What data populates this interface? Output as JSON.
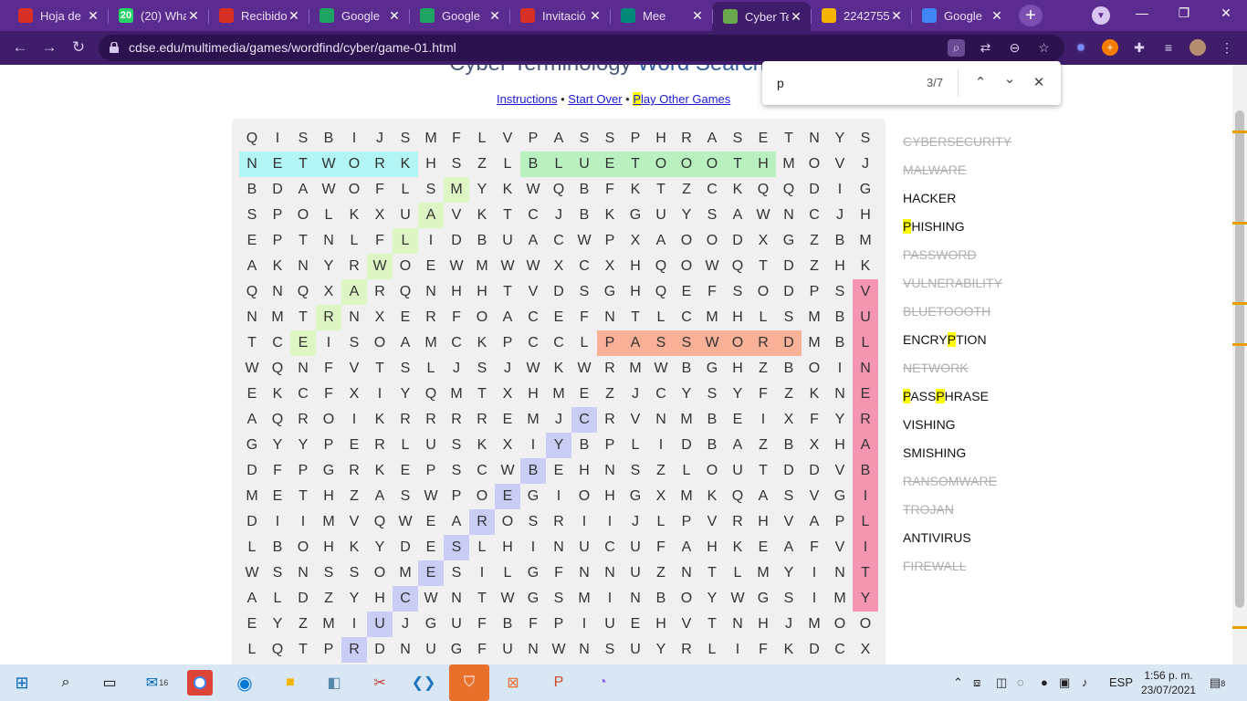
{
  "tabs": [
    {
      "title": "Hoja de",
      "icon": "gmail-icon",
      "color": "#d93025"
    },
    {
      "title": "(20) Wha",
      "icon": "whatsapp-icon",
      "color": "#25d366",
      "badge": "20"
    },
    {
      "title": "Recibido",
      "icon": "gmail-icon",
      "color": "#d93025"
    },
    {
      "title": "Google",
      "icon": "google-drive-icon",
      "color": "#1fa463"
    },
    {
      "title": "Google",
      "icon": "google-drive-icon",
      "color": "#1fa463"
    },
    {
      "title": "Invitació",
      "icon": "gmail-icon",
      "color": "#d93025"
    },
    {
      "title": "Mee",
      "icon": "google-meet-icon",
      "color": "#00897b"
    },
    {
      "title": "Cyber Te",
      "icon": "cdse-icon",
      "color": "#6aa84f"
    },
    {
      "title": "2242755",
      "icon": "google-drive-icon",
      "color": "#f4b400"
    },
    {
      "title": "Google",
      "icon": "google-icon",
      "color": "#4285f4"
    }
  ],
  "address_bar": {
    "url": "cdse.edu/multimedia/games/wordfind/cyber/game-01.html"
  },
  "page": {
    "title_part1": "Cyber Terminology",
    "title_part2": "Word Search",
    "links": {
      "instructions": "Instructions",
      "start_over": "Start Over",
      "play_other_p": "P",
      "play_other_rest": "lay Other Games",
      "separator": "•"
    }
  },
  "find_bar": {
    "query": "p",
    "count": "3/7"
  },
  "grid": [
    "QISBIJSMFLVPASSPHRASETNYS",
    "NETWORKHSZLBLUETOOOTHMOVJ",
    "BDAWOFLSMYKWQBFKTZCKQQDIG",
    "SPOLKXUAVKTCJBKGUYSAWNCJH",
    "EPTNLFLIDBUACWPXAOODXGZBM",
    "AKNYRWOEWMWWXCXHQOWQTDZHK",
    "QNQXARQNHHTVDSGHQEFSODPSV",
    "NMTRNXERFOACEFNTLCMHLSMBU",
    "TCEISOAMCKPCCLPASSWORDMBL",
    "WQNFVTSLJSJWKWRMWBGHZBOIN",
    "EKCFXIYQMTXHMEZJCYSYFZKNE",
    "AQROIKRRRREMJCRVNMBEIXFYR",
    "GYYPERLUSKXIYBPLIDBAZBXHA",
    "DFPGRKEPSCWBEHNSZLOUTDDVB",
    "METHZASWPOEGIOHGXMKQASVGI",
    "DIIMVQWEAROSRIIJLPVRHVAPL",
    "LBOHKYDESLHINUCUFAHKEAFVI",
    "WSNSSOMESILGFNNUZNTLMYINT",
    "ALDZYHCWNTWGSMINBOYWGSIMY",
    "EYZMIUJGUFBFPIUEHVTNHJMOO",
    "LQTPRDNUGFUNWNSUYRLIFKDCX"
  ],
  "found_words": [
    {
      "name": "network",
      "color": "#b3f5f5",
      "type": "h",
      "row": 1,
      "col": 0,
      "len": 7
    },
    {
      "name": "bluetoooth",
      "color": "#b9f0bf",
      "type": "h",
      "row": 1,
      "col": 11,
      "len": 10
    },
    {
      "name": "password",
      "color": "#f8b196",
      "type": "h",
      "row": 8,
      "col": 14,
      "len": 8
    },
    {
      "name": "vulnerability",
      "color": "#f596b0",
      "type": "v",
      "row": 6,
      "col": 24,
      "len": 13
    },
    {
      "name": "malware",
      "color": "#ddf5c4",
      "type": "diag",
      "row": 2,
      "col": 8,
      "len": 7,
      "dr": 1,
      "dc": -1
    },
    {
      "name": "cybersecurity",
      "color": "#c9ccf5",
      "type": "diag",
      "row": 11,
      "col": 13,
      "len": 10,
      "dr": 1,
      "dc": -1
    }
  ],
  "word_list": [
    {
      "parts": [
        [
          "CYBERSECURITY",
          false
        ]
      ],
      "found": true
    },
    {
      "parts": [
        [
          "MALWARE",
          false
        ]
      ],
      "found": true
    },
    {
      "parts": [
        [
          "HACKER",
          false
        ]
      ],
      "found": false
    },
    {
      "parts": [
        [
          "P",
          true
        ],
        [
          "HISHING",
          false
        ]
      ],
      "found": false
    },
    {
      "parts": [
        [
          "PASSWORD",
          false
        ]
      ],
      "found": true
    },
    {
      "parts": [
        [
          "VULNERABILITY",
          false
        ]
      ],
      "found": true
    },
    {
      "parts": [
        [
          "BLUETOOOTH",
          false
        ]
      ],
      "found": true
    },
    {
      "parts": [
        [
          "ENCRY",
          false
        ],
        [
          "P",
          true
        ],
        [
          "TION",
          false
        ]
      ],
      "found": false
    },
    {
      "parts": [
        [
          "NETWORK",
          false
        ]
      ],
      "found": true
    },
    {
      "parts": [
        [
          "P",
          true
        ],
        [
          "ASS",
          false
        ],
        [
          "P",
          true
        ],
        [
          "HRASE",
          false
        ]
      ],
      "found": false
    },
    {
      "parts": [
        [
          "VISHING",
          false
        ]
      ],
      "found": false
    },
    {
      "parts": [
        [
          "SMISHING",
          false
        ]
      ],
      "found": false
    },
    {
      "parts": [
        [
          "RANSOMWARE",
          false
        ]
      ],
      "found": true
    },
    {
      "parts": [
        [
          "TROJAN",
          false
        ]
      ],
      "found": true
    },
    {
      "parts": [
        [
          "ANTIVIRUS",
          false
        ]
      ],
      "found": false
    },
    {
      "parts": [
        [
          "FIREWALL",
          false
        ]
      ],
      "found": true
    }
  ],
  "taskbar": {
    "mail_badge": "16",
    "language": "ESP",
    "time": "1:56 p. m.",
    "date": "23/07/2021",
    "notifications": "8"
  }
}
